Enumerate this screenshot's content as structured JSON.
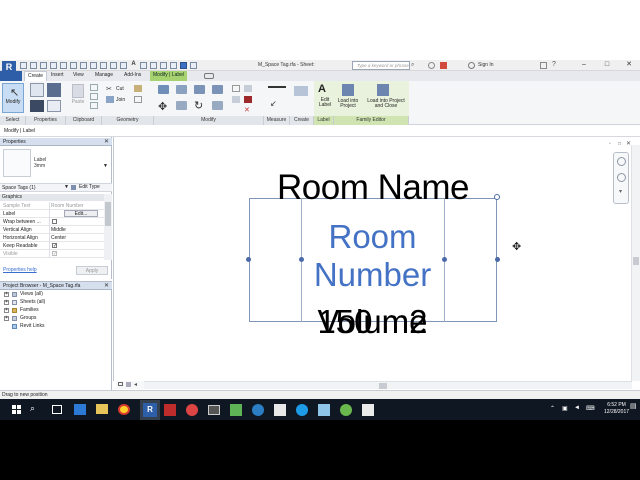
{
  "window": {
    "app_logo": "R",
    "document_title": "M_Space Tag.rfa - Sheet:",
    "search_placeholder": "Type a keyword or phrase",
    "sign_in": "Sign In",
    "controls": [
      "–",
      "□",
      "✕"
    ]
  },
  "tabs": [
    {
      "label": "Create",
      "state": "active"
    },
    {
      "label": "Insert",
      "state": "normal"
    },
    {
      "label": "View",
      "state": "normal"
    },
    {
      "label": "Manage",
      "state": "normal"
    },
    {
      "label": "Add-Ins",
      "state": "normal"
    },
    {
      "label": "Modify | Label",
      "state": "contextual"
    }
  ],
  "ribbon": {
    "modify_label": "Modify",
    "panels": [
      "Select",
      "Properties",
      "Clipboard",
      "Geometry",
      "Modify",
      "Measure",
      "Create",
      "Label",
      "Family Editor"
    ],
    "cut_label": "Cut",
    "join_label": "Join",
    "paste_label": "Paste",
    "edit_label_btn": "Edit Label",
    "load_into_project": "Load into Project",
    "load_and_close": "Load into Project and Close"
  },
  "option_bar": {
    "context": "Modify | Label"
  },
  "properties": {
    "header": "Properties",
    "type_name": "Label",
    "type_size": "3mm",
    "selector": "Space Tags (1)",
    "edit_type": "Edit Type",
    "group": "Graphics",
    "rows": [
      {
        "name": "Sample Text",
        "value": "Room Number"
      },
      {
        "name": "Label",
        "value": "Edit..."
      },
      {
        "name": "Wrap between ...",
        "value": ""
      },
      {
        "name": "Vertical Align",
        "value": "Middle"
      },
      {
        "name": "Horizontal Align",
        "value": "Center"
      },
      {
        "name": "Keep Readable",
        "value": "✓"
      },
      {
        "name": "Visible",
        "value": "✓"
      }
    ],
    "help_link": "Properties help",
    "apply": "Apply"
  },
  "project_browser": {
    "header": "Project Browser - M_Space Tag.rfa",
    "items": [
      {
        "label": "Views (all)",
        "expand": "+"
      },
      {
        "label": "Sheets (all)",
        "expand": "+"
      },
      {
        "label": "Families",
        "expand": "+"
      },
      {
        "label": "Groups",
        "expand": "+"
      },
      {
        "label": "Revit Links",
        "expand": ""
      }
    ]
  },
  "canvas": {
    "room_name": "Room Name",
    "room_number_line1": "Room",
    "room_number_line2": "Number",
    "overlap_text_a": "Volume",
    "overlap_text_b": "150 m2"
  },
  "statusbar": {
    "text": "Drag to new position"
  },
  "taskbar": {
    "time": "6:52 PM",
    "date": "12/28/2017"
  },
  "colors": {
    "accent_blue": "#4472c4",
    "contextual_tab": "#a6d36f",
    "taskbar": "#0f1722"
  }
}
